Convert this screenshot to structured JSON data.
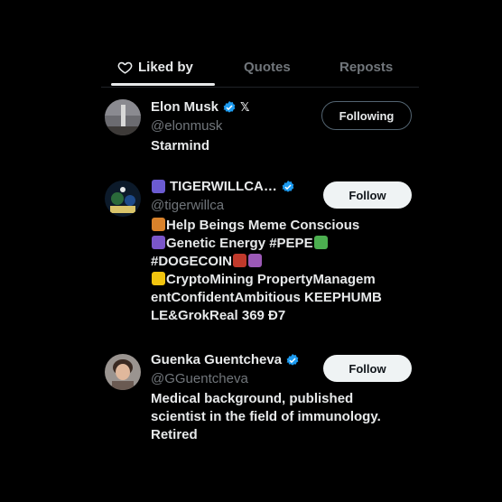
{
  "tabs": [
    {
      "label": "Liked by",
      "active": true
    },
    {
      "label": "Quotes",
      "active": false
    },
    {
      "label": "Reposts",
      "active": false
    }
  ],
  "users": [
    {
      "name": "Elon Musk",
      "handle": "@elonmusk",
      "bio": "Starmind",
      "button": "Following",
      "verified": true,
      "affiliation_icon": "x-logo-icon",
      "affiliation_label": "𝕏"
    },
    {
      "name": "TIGERWILLCA…",
      "handle": "@tigerwillca",
      "bio_lines": [
        "Help Beings Meme Conscious",
        "Genetic Energy #PEPE",
        "#DOGECOIN",
        "CryptoMining PropertyManagem",
        "entConfidentAmbitious KEEPHUMB",
        "LE&GrokReal 369 Đ7"
      ],
      "button": "Follow",
      "verified": true
    },
    {
      "name": "Guenka Guentcheva",
      "handle": "@GGuentcheva",
      "bio_lines": [
        "Medical background, published",
        "scientist in the field of immunology.",
        "Retired"
      ],
      "button": "Follow",
      "verified": true
    }
  ],
  "colors": {
    "background": "#000000",
    "text": "#e7e9ea",
    "muted": "#71767b",
    "verified": "#1d9bf0",
    "follow_bg": "#eff3f4"
  }
}
